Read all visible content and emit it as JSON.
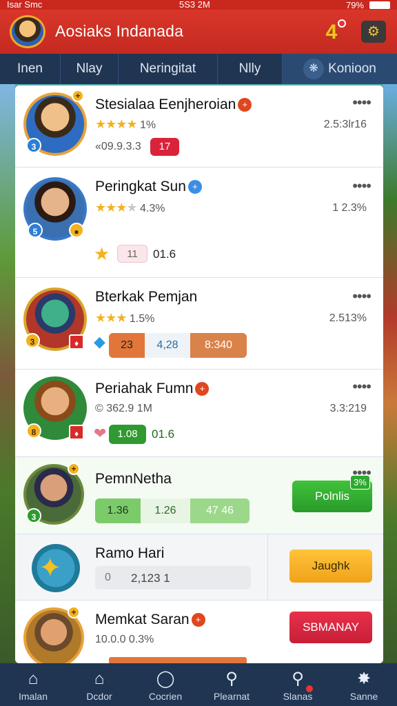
{
  "status_bar": {
    "carrier": "Isar Smc",
    "time": "5S3 2M",
    "battery": "79%"
  },
  "header": {
    "title": "Aosiaks Indanada",
    "badge_button_label": "4"
  },
  "tabs": [
    {
      "label": "Inen",
      "active": false
    },
    {
      "label": "Nlay",
      "active": false
    },
    {
      "label": "Neringitat",
      "active": false
    },
    {
      "label": "Nlly",
      "active": false
    },
    {
      "label": "Konioon",
      "active": true
    }
  ],
  "players": [
    {
      "name": "Stesialaa Eenjheroian",
      "rating_stars": 4,
      "rating_text": "1%",
      "right_value": "2.5:3lr16",
      "detail": "«09.9.3.3",
      "chip": "17",
      "level_badge": "3"
    },
    {
      "name": "Peringkat Sun",
      "rating_stars": 3,
      "rating_text": "4.3%",
      "right_value": "1 2.3%",
      "chip": "11",
      "chip_value": "01.6",
      "level_badge": "5"
    },
    {
      "name": "Bterkak Pemjan",
      "rating_stars": 3,
      "rating_text": "1.5%",
      "right_value": "2.513%",
      "segments": [
        "23",
        "4,28",
        "8:340"
      ],
      "level_badge": "3"
    },
    {
      "name": "Periahak Fumn",
      "detail": "© 362.9 1M",
      "right_value": "3.3:219",
      "chip": "1.08",
      "chip_value": "01.6",
      "level_badge": "8"
    },
    {
      "name": "PemnNetha",
      "segments": [
        "1.36",
        "1.26",
        "47 46"
      ],
      "action_label": "Polnlis",
      "action_tag": "3%",
      "level_badge": "3"
    },
    {
      "name": "Ramo Hari",
      "input_icon": "0",
      "input_value": "2,123 1",
      "action_label": "Jaughk"
    },
    {
      "name": "Memkat Saran",
      "detail": "10.0.0 0.3%",
      "action_label": "SBMANAY"
    }
  ],
  "bottom_nav": [
    {
      "label": "Imalan",
      "icon": "home-icon"
    },
    {
      "label": "Dcdor",
      "icon": "house-outline-icon"
    },
    {
      "label": "Cocrien",
      "icon": "compass-icon"
    },
    {
      "label": "Plearnat",
      "icon": "search-icon"
    },
    {
      "label": "Slanas",
      "icon": "magnify-badge-icon"
    },
    {
      "label": "Sanne",
      "icon": "gear-icon"
    }
  ]
}
